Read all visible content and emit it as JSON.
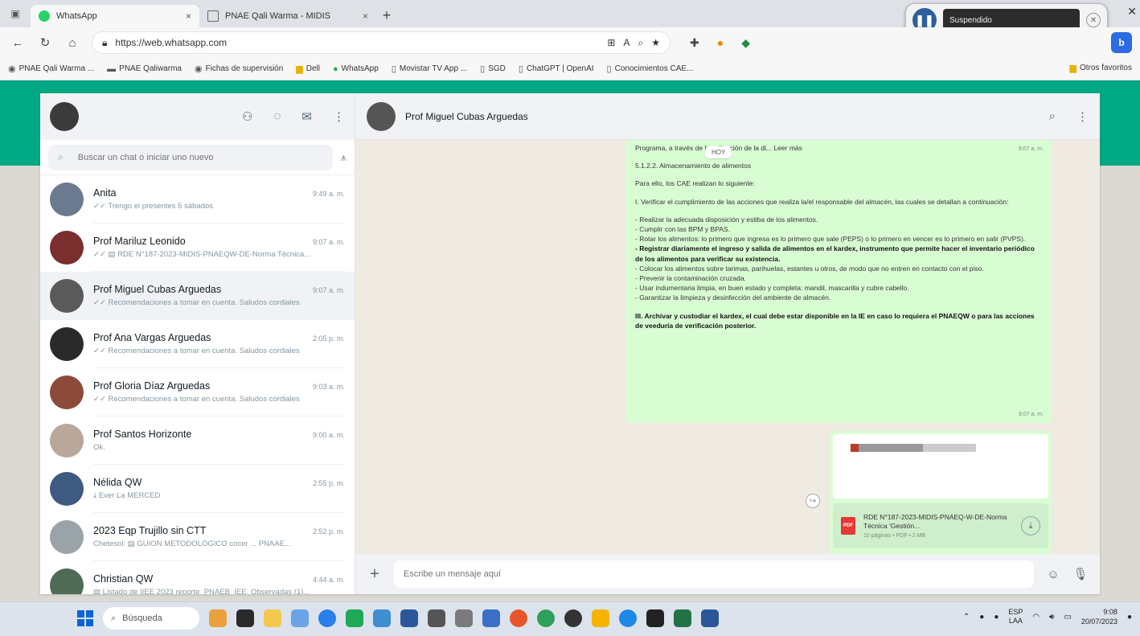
{
  "browser": {
    "tabs": [
      {
        "label": "WhatsApp",
        "close": "×"
      },
      {
        "label": "PNAE Qali Warma - MIDIS",
        "close": "×"
      }
    ],
    "new_tab": "+",
    "url": "https://web.whatsapp.com",
    "notification": {
      "text": "Suspendido"
    },
    "bookmarks": [
      {
        "icon": "q",
        "label": "PNAE Qali Warma ..."
      },
      {
        "icon": "b",
        "label": "PNAE Qaliwarma"
      },
      {
        "icon": "q",
        "label": "Fichas de supervisión"
      },
      {
        "icon": "f",
        "label": "Dell"
      },
      {
        "icon": "g",
        "label": "WhatsApp"
      },
      {
        "icon": "p",
        "label": "Movistar TV App ..."
      },
      {
        "icon": "p",
        "label": "SGD"
      },
      {
        "icon": "p",
        "label": "ChatGPT | OpenAI"
      },
      {
        "icon": "p",
        "label": "Conocimientos CAE..."
      }
    ],
    "other_favorites": "Otros favoritos"
  },
  "sidebar": {
    "search_placeholder": "Buscar un chat o iniciar uno nuevo",
    "chats": [
      {
        "name": "Anita",
        "time": "9:49 a. m.",
        "preview": "✓✓ Trengo el presentes 5 sábados",
        "avatar_color": "#6b7a8f"
      },
      {
        "name": "Prof Mariluz Leonido",
        "time": "9:07 a. m.",
        "preview": "✓✓ ▤ RDE N°187-2023-MIDIS-PNAEQW-DE-Norma Técnica...",
        "avatar_color": "#7a2e2e"
      },
      {
        "name": "Prof Miguel Cubas Arguedas",
        "time": "9:07 a. m.",
        "preview": "✓✓ Recomendaciones a tomar en cuenta. Saludos cordiales",
        "avatar_color": "#5a5a5a"
      },
      {
        "name": "Prof Ana Vargas Arguedas",
        "time": "2:05 p. m.",
        "preview": "✓✓ Recomendaciones a tomar en cuenta. Saludos cordiales",
        "avatar_color": "#2a2a2a"
      },
      {
        "name": "Prof Gloria Díaz Arguedas",
        "time": "9:03 a. m.",
        "preview": "✓✓ Recomendaciones a tomar en cuenta. Saludos cordiales",
        "avatar_color": "#8c4a3a"
      },
      {
        "name": "Prof Santos Horizonte",
        "time": "9:00 a. m.",
        "preview": "Ok.",
        "avatar_color": "#b8a79a"
      },
      {
        "name": "Nélida QW",
        "time": "2:55 p. m.",
        "preview": "⤓ Ever La MERCED",
        "avatar_color": "#3d5a80"
      },
      {
        "name": "2023 Eqp Trujillo sin CTT",
        "time": "2:52 p. m.",
        "preview": "Chetesol: ▤ GUION METODOLÓGICO cocer ... PNAAE...",
        "avatar_color": "#9aa3a8"
      },
      {
        "name": "Christian QW",
        "time": "4:44 a. m.",
        "preview": "▤ Listado de IIEE 2023 reporte_PNAEB_IEE_Observadas (1)...",
        "avatar_color": "#4f6b55"
      }
    ]
  },
  "conversation": {
    "contact_name": "Prof Miguel Cubas Arguedas",
    "date_pill": "HOY",
    "message_lines": [
      {
        "t": "Programa, a través de la aplicación de la di... Leer más",
        "s": "n"
      },
      {
        "t": "5.1.2.2. Almacenamiento de alimentos",
        "s": "n"
      },
      {
        "t": "Para ello, los CAE realizan lo siguiente:",
        "s": "n"
      },
      {
        "t": "I. Verificar el cumplimiento de las acciones que realiza la/el responsable del almacén, las cuales se detallan a continuación:",
        "s": "n"
      },
      {
        "t": "-      Realizar la adecuada disposición y estiba de los alimentos.",
        "s": "n"
      },
      {
        "t": "-      Cumplir con las BPM y BPAS.",
        "s": "n"
      },
      {
        "t": "-      Rotar los alimentos: lo primero que ingresa es lo primero que sale (PEPS) o lo primero en vencer es lo primero en salir (PVPS).",
        "s": "n"
      },
      {
        "t": "-      Registrar diariamente el ingreso y salida de alimentos en el kardex, instrumento que permite hacer el inventario periódico de los alimentos para verificar su existencia.",
        "s": "b"
      },
      {
        "t": "-      Colocar los alimentos sobre tarimas, parihuelas, estantes u otros, de modo que no entren en contacto con el piso.",
        "s": "n"
      },
      {
        "t": "-      Prevenir la contaminación cruzada.",
        "s": "n"
      },
      {
        "t": "-      Usar indumentaria limpia, en buen estado y completa: mandil, mascarilla y cubre cabello.",
        "s": "n"
      },
      {
        "t": "-      Garantizar la limpieza y desinfección del ambiente de almacén.",
        "s": "n"
      },
      {
        "t": "III. Archivar y custodiar el kardex, el cual debe estar disponible en la IE en caso lo requiera el PNAEQW o para las acciones de veeduría de verificación posterior.",
        "s": "b"
      }
    ],
    "msg_time_1": "9:07 a. m.",
    "msg_time_2": "9:07 a. m.",
    "msg_time_3": "9:07 a. m.",
    "document": {
      "badge": "PDF",
      "title": "RDE N°187-2023-MIDIS-PNAEQ-W-DE-Norma Técnica 'Gestión...",
      "meta": "10 páginas • PDF • 2 MB"
    },
    "composer_placeholder": "Escribe un mensaje aquí"
  },
  "taskbar": {
    "search_label": "Búsqueda",
    "lang_top": "ESP",
    "lang_bottom": "LAA",
    "time": "9:08",
    "date": "20/07/2023"
  },
  "colors": {
    "wa_green": "#00a884",
    "bubble": "#d9fdd3"
  }
}
